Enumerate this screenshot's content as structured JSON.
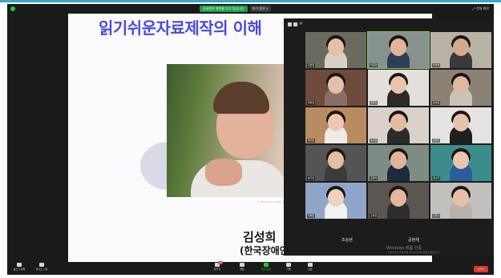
{
  "topbar": {
    "share_label": "김세정의 화면을 보고 있습니다",
    "view_options": "보기 옵션 ∨",
    "fullscreen": "⤢ 전체 화면"
  },
  "slide": {
    "title": "읽기쉬운자료제작의 이해",
    "caption": "© PhotoAlto / Alamy 참고",
    "speaker_name": "김성희",
    "speaker_org": "(한국장애인"
  },
  "gallery": {
    "tiles": [
      {
        "name": "김현진",
        "bg": "#6b6a60",
        "skin": "#e8c0a6",
        "shirt": "#d9d0c4"
      },
      {
        "name": "이준영",
        "bg": "#87928e",
        "skin": "#e2b599",
        "shirt": "#2f3f5a"
      },
      {
        "name": "임성재",
        "bg": "#b7b2a4",
        "skin": "#d7a98e",
        "shirt": "#3a3a3a"
      },
      {
        "name": "박하늘",
        "bg": "#6d4b3d",
        "skin": "#e5bfa7",
        "shirt": "#8a7064"
      },
      {
        "name": "최유진",
        "bg": "#e3e0dc",
        "skin": "#e9c4ac",
        "shirt": "#2a2a2a"
      },
      {
        "name": "정다은",
        "bg": "#8b8275",
        "skin": "#e0b89f",
        "shirt": "#c9c3b8"
      },
      {
        "name": "한지민",
        "bg": "#b98b61",
        "skin": "#ecc8b2",
        "shirt": "#efeae4"
      },
      {
        "name": "윤서연",
        "bg": "#d8d2cb",
        "skin": "#e4bca3",
        "shirt": "#2b2b2b"
      },
      {
        "name": "강민지",
        "bg": "#e6e4e2",
        "skin": "#e7c3ab",
        "shirt": "#1f1f1f"
      },
      {
        "name": "송가은",
        "bg": "#545454",
        "skin": "#e4bfa5",
        "shirt": "#3b3b3b"
      },
      {
        "name": "조은비",
        "bg": "#7f8c86",
        "skin": "#dfb69c",
        "shirt": "#1c2c3c"
      },
      {
        "name": "문소희",
        "bg": "#3b8d8c",
        "skin": "#e9c6ad",
        "shirt": "#2a5d9a"
      },
      {
        "name": "서예린",
        "bg": "#8fa6c9",
        "skin": "#ecd3c2",
        "shirt": "#f2f2f2"
      },
      {
        "name": "오하은",
        "bg": "#5c5650",
        "skin": "#e1b89e",
        "shirt": "#2d2d2d"
      },
      {
        "name": "신유나",
        "bg": "#c2c0bd",
        "skin": "#e6c0a7",
        "shirt": "#b8b2ab"
      }
    ],
    "foot_left": "조승현",
    "foot_right": "공현재",
    "watermark": "Windows 정품 인증",
    "watermark_sub": "[설정]으로 이동하여 Windows를 정품 인증합니다."
  },
  "bottombar": {
    "mute": "음소거 해제",
    "video": "비디오 시작",
    "participants": "참가자",
    "participants_count": "31",
    "chat": "채팅",
    "share": "화면 공유",
    "record": "기록",
    "reactions": "반응",
    "end": "나가기"
  },
  "colors": {
    "accent_green": "#27c24c",
    "end_red": "#d63a2f",
    "title_blue": "#4a4ad8"
  }
}
